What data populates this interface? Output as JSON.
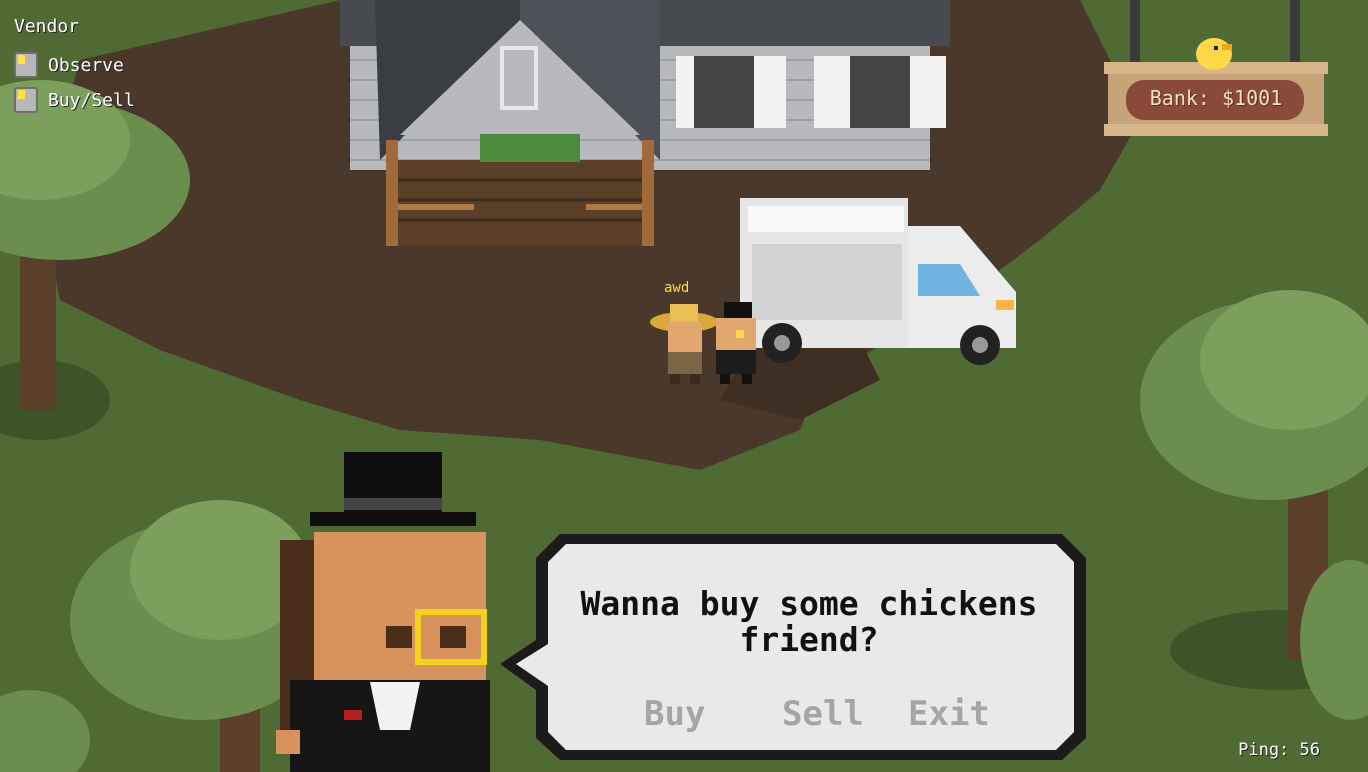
{
  "hud": {
    "title": "Vendor",
    "actions": [
      {
        "label": "Observe",
        "icon": "key-icon"
      },
      {
        "label": "Buy/Sell",
        "icon": "key-icon"
      }
    ]
  },
  "bank": {
    "label": "Bank: $1001",
    "icon": "chick-icon"
  },
  "player": {
    "name": "awd"
  },
  "dialog": {
    "message": "Wanna buy some chickens friend?",
    "options": [
      "Buy",
      "Sell",
      "Exit"
    ]
  },
  "status": {
    "ping": "Ping: 56"
  },
  "colors": {
    "grass": "#4f6a33",
    "dirt": "#4a382a",
    "tree": "#6b8e4e",
    "bank_sign": "#8a4a3a",
    "accent": "#ffd84a"
  }
}
